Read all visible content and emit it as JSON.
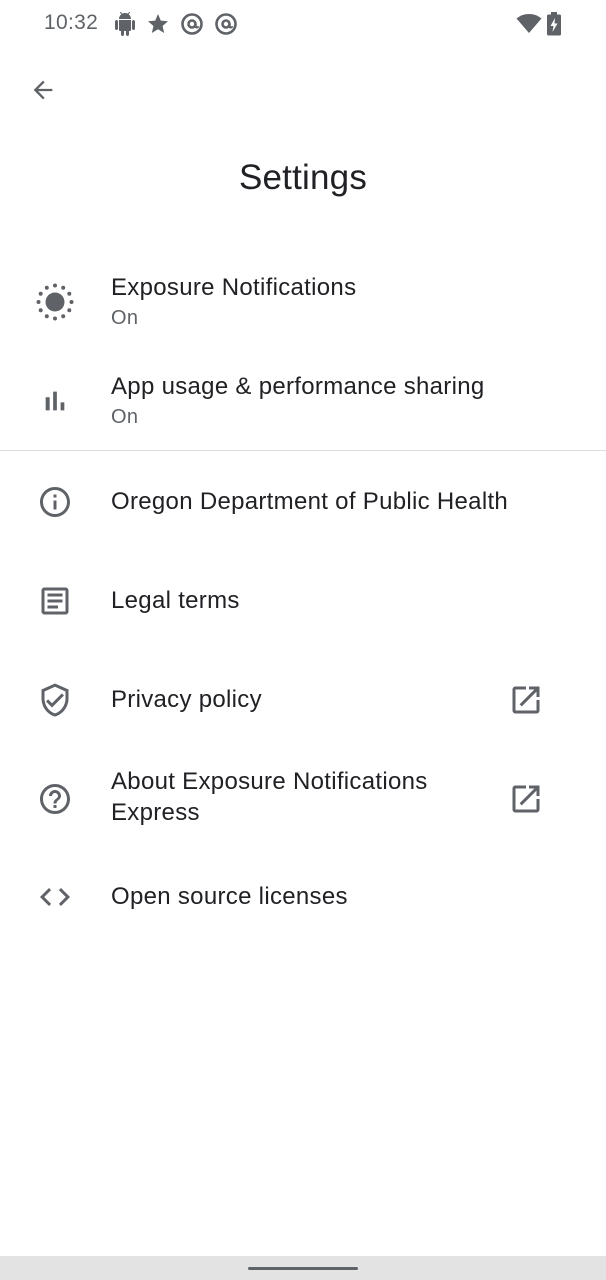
{
  "status_bar": {
    "time": "10:32",
    "icons": [
      "android-icon",
      "star-icon",
      "at-sign-icon",
      "at-sign-icon",
      "wifi-icon",
      "battery-charging-icon"
    ]
  },
  "header": {
    "back_icon": "arrow-back-icon",
    "title": "Settings"
  },
  "settings": {
    "exposure_notifications": {
      "icon": "exposure-icon",
      "label": "Exposure Notifications",
      "status": "On"
    },
    "app_usage": {
      "icon": "bar-chart-icon",
      "label": "App usage & performance sharing",
      "status": "On"
    },
    "health_authority": {
      "icon": "info-icon",
      "label": "Oregon Department of Public Health"
    },
    "legal_terms": {
      "icon": "article-icon",
      "label": "Legal terms"
    },
    "privacy_policy": {
      "icon": "shield-check-icon",
      "label": "Privacy policy",
      "trailing_icon": "open-in-new-icon"
    },
    "about": {
      "icon": "help-icon",
      "label_line1": "About Exposure Notifications",
      "label_line2": "Express",
      "trailing_icon": "open-in-new-icon"
    },
    "open_source": {
      "icon": "code-icon",
      "label": "Open source licenses"
    }
  },
  "colors": {
    "text_primary": "#202124",
    "text_secondary": "#5f6368",
    "icon": "#5f6368",
    "divider": "#dadce0",
    "nav_bar": "#e3e3e3"
  }
}
